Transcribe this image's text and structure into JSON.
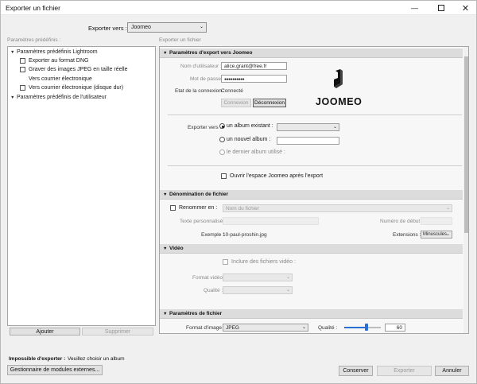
{
  "window": {
    "title": "Exporter un fichier"
  },
  "export_to": {
    "label": "Exporter vers :",
    "value": "Joomeo"
  },
  "presets": {
    "heading": "Paramètres prédéfinis :",
    "group1": "Paramètres prédéfinis Lightroom",
    "items": [
      "Exporter au format DNG",
      "Graver des images JPEG en taille réelle",
      "Vers courrier électronique",
      "Vers courrier électronique (disque dur)"
    ],
    "group2": "Paramètres prédéfinis de l'utilisateur",
    "add_label": "Ajouter",
    "remove_label": "Supprimer"
  },
  "right_heading": "Exporter un fichier",
  "joomeo_section": {
    "title": "Paramètres d'export vers Joomeo",
    "username_label": "Nom d'utilisateur :",
    "username_value": "alice.grant@free.fr",
    "password_label": "Mot de passe :",
    "password_value": "●●●●●●●●●●",
    "status_label": "Etat de la connexion :",
    "status_value": "Connecté",
    "connect_label": "Connexion",
    "disconnect_label": "Déconnexion",
    "brand": "JOOMEO",
    "export_to_label": "Exporter vers :",
    "existing_album_label": "un album existant :",
    "new_album_label": "un nouvel album :",
    "last_album_label": "le dernier album utilisé :",
    "open_space_label": "Ouvrir l'espace Joomeo après l'export"
  },
  "naming_section": {
    "title": "Dénomination de fichier",
    "rename_label": "Renommer en :",
    "rename_value": "Nom du fichier",
    "custom_text_label": "Texte personnalisé :",
    "start_number_label": "Numéro de début :",
    "example_label": "Exemple :",
    "example_value": "10-paul-proshin.jpg",
    "extensions_label": "Extensions :",
    "extensions_value": "Minuscules"
  },
  "video_section": {
    "title": "Vidéo",
    "include_label": "Inclure des fichiers vidéo :",
    "format_label": "Format vidéo :",
    "quality_label": "Qualité :"
  },
  "file_section": {
    "title": "Paramètres de fichier",
    "format_label": "Format d'image :",
    "format_value": "JPEG",
    "quality_label": "Qualité :",
    "quality_value": "60",
    "quality_level": 0.6
  },
  "footer": {
    "error_title": "Impossible d'exporter :",
    "error_text": "Veuillez choisir un album",
    "plugin_manager_label": "Gestionnaire de modules externes...",
    "keep_label": "Conserver",
    "export_label": "Exporter",
    "cancel_label": "Annuler"
  }
}
